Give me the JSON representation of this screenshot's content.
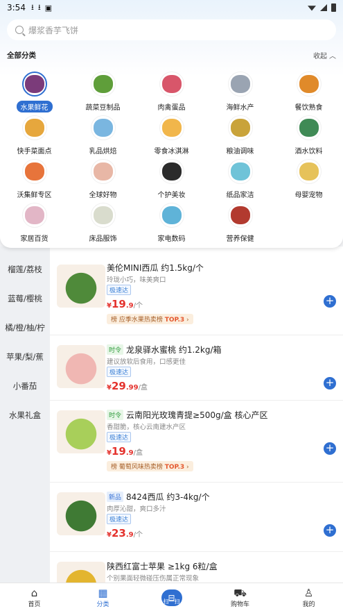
{
  "status": {
    "time": "3:54"
  },
  "search": {
    "placeholder": "爆浆香芋飞饼"
  },
  "panel": {
    "title": "全部分类",
    "collapse": "收起"
  },
  "categories": [
    {
      "label": "水果鲜花",
      "icon": "grape-icon",
      "color": "#7b3b7a",
      "selected": true
    },
    {
      "label": "蔬菜豆制品",
      "icon": "vegetable-icon",
      "color": "#5f9e3a"
    },
    {
      "label": "肉禽蛋品",
      "icon": "meat-icon",
      "color": "#d8566a"
    },
    {
      "label": "海鲜水产",
      "icon": "fish-icon",
      "color": "#9aa4b2"
    },
    {
      "label": "餐饮熟食",
      "icon": "prepared-food-icon",
      "color": "#e08a2a"
    },
    {
      "label": "快手菜面点",
      "icon": "dumpling-icon",
      "color": "#e6a73d"
    },
    {
      "label": "乳品烘焙",
      "icon": "milk-icon",
      "color": "#7ab6e0"
    },
    {
      "label": "零食冰淇淋",
      "icon": "snack-icon",
      "color": "#f1b64b"
    },
    {
      "label": "粮油调味",
      "icon": "oil-icon",
      "color": "#c9a33a"
    },
    {
      "label": "酒水饮料",
      "icon": "drink-icon",
      "color": "#3f8a55"
    },
    {
      "label": "沃集鲜专区",
      "icon": "basket-icon",
      "color": "#e7743b"
    },
    {
      "label": "全球好物",
      "icon": "bottle-icon",
      "color": "#e8b7a6"
    },
    {
      "label": "个护美妆",
      "icon": "cosmetics-icon",
      "color": "#2b2b2b"
    },
    {
      "label": "纸品家洁",
      "icon": "tissue-icon",
      "color": "#6fc3d8"
    },
    {
      "label": "母婴宠物",
      "icon": "formula-icon",
      "color": "#e6c25a"
    },
    {
      "label": "家居百货",
      "icon": "cup-icon",
      "color": "#e2b6c6"
    },
    {
      "label": "床品服饰",
      "icon": "clothing-icon",
      "color": "#d9dccd"
    },
    {
      "label": "家电数码",
      "icon": "fan-icon",
      "color": "#5fb3d8"
    },
    {
      "label": "营养保健",
      "icon": "giftbox-icon",
      "color": "#b23a2f"
    }
  ],
  "sidebar": [
    "榴莲/荔枝",
    "蓝莓/樱桃",
    "橘/橙/柚/柠",
    "苹果/梨/蕉",
    "小番茄",
    "水果礼盒"
  ],
  "products": [
    {
      "tag": "",
      "title": "美伦MINI西瓜 约1.5kg/个",
      "subtitle": "玲珑小巧，味美爽口",
      "fast": "极速达",
      "price_int": "19",
      "price_dec": ".9",
      "unit": "/个",
      "rank_pre": "应季水果热卖榜",
      "rank_top": "TOP.3",
      "img_color": "#4f8a3a"
    },
    {
      "tag": "时令",
      "title": "龙泉驿水蜜桃 约1.2kg/箱",
      "subtitle": "建议放软后食用，口感更佳",
      "fast": "极速达",
      "price_int": "29",
      "price_dec": ".99",
      "unit": "/盒",
      "rank_pre": "",
      "rank_top": "",
      "img_color": "#f0b7b3"
    },
    {
      "tag": "时令",
      "title": "云南阳光玫瑰青提≥500g/盒 核心产区",
      "subtitle": "香甜脆，核心云南建水产区",
      "fast": "极速达",
      "price_int": "19",
      "price_dec": ".9",
      "unit": "/盒",
      "rank_pre": "葡萄风味热卖榜",
      "rank_top": "TOP.3",
      "img_color": "#a8cf5a"
    },
    {
      "tag": "新品",
      "title": "8424西瓜 约3-4kg/个",
      "subtitle": "肉厚沁甜，爽口多汁",
      "fast": "极速达",
      "price_int": "23",
      "price_dec": ".9",
      "unit": "/个",
      "rank_pre": "",
      "rank_top": "",
      "img_color": "#3f7a34"
    },
    {
      "tag": "",
      "title": "陕西红富士苹果 ≥1kg 6粒/盒",
      "subtitle": "个别果面轻微碰压伤属正常现象",
      "fast": "",
      "price_int": "",
      "price_dec": "",
      "unit": "",
      "rank_pre": "",
      "rank_top": "",
      "img_color": "#e3b52f"
    }
  ],
  "price_symbol": "¥",
  "tabs": [
    {
      "label": "首页",
      "icon": "home-icon",
      "glyph": "⌂"
    },
    {
      "label": "分类",
      "icon": "category-icon",
      "glyph": "▦",
      "active": true
    },
    {
      "label": "扫一扫",
      "icon": "scan-icon",
      "glyph": "⊟"
    },
    {
      "label": "购物车",
      "icon": "cart-icon",
      "glyph": "⛟"
    },
    {
      "label": "我的",
      "icon": "profile-icon",
      "glyph": "♙"
    }
  ]
}
